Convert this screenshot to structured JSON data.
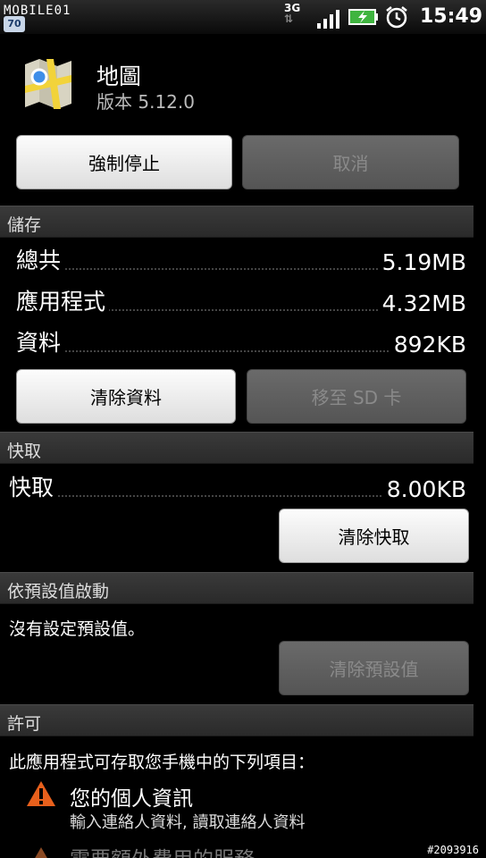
{
  "status_bar": {
    "watermark": "MOBILE01",
    "notification_badge": "70",
    "network": "3G",
    "time": "15:49",
    "icons": [
      "signal-icon",
      "battery-charging-icon",
      "alarm-icon"
    ]
  },
  "app": {
    "name": "地圖",
    "version": "版本 5.12.0"
  },
  "actions": {
    "force_stop": "強制停止",
    "cancel": "取消"
  },
  "storage": {
    "header": "儲存",
    "rows": [
      {
        "label": "總共",
        "value": "5.19MB"
      },
      {
        "label": "應用程式",
        "value": "4.32MB"
      },
      {
        "label": "資料",
        "value": "892KB"
      }
    ],
    "clear_data": "清除資料",
    "move_to_sd": "移至 SD 卡"
  },
  "cache": {
    "header": "快取",
    "label": "快取",
    "value": "8.00KB",
    "clear_cache": "清除快取"
  },
  "defaults": {
    "header": "依預設值啟動",
    "message": "沒有設定預設值。",
    "clear_defaults": "清除預設值"
  },
  "permissions": {
    "header": "許可",
    "intro": "此應用程式可存取您手機中的下列項目：",
    "items": [
      {
        "title": "您的個人資訊",
        "detail": "輸入連絡人資料, 讀取連絡人資料"
      },
      {
        "title": "需要額外費用的服務",
        "detail": ""
      }
    ]
  },
  "footer_id": "#2093916",
  "colors": {
    "background": "#000000",
    "section_header": "#2e2e2e",
    "button_enabled": "#f0f0f0",
    "button_disabled": "#5e5e5e",
    "warning": "#e8601c"
  }
}
